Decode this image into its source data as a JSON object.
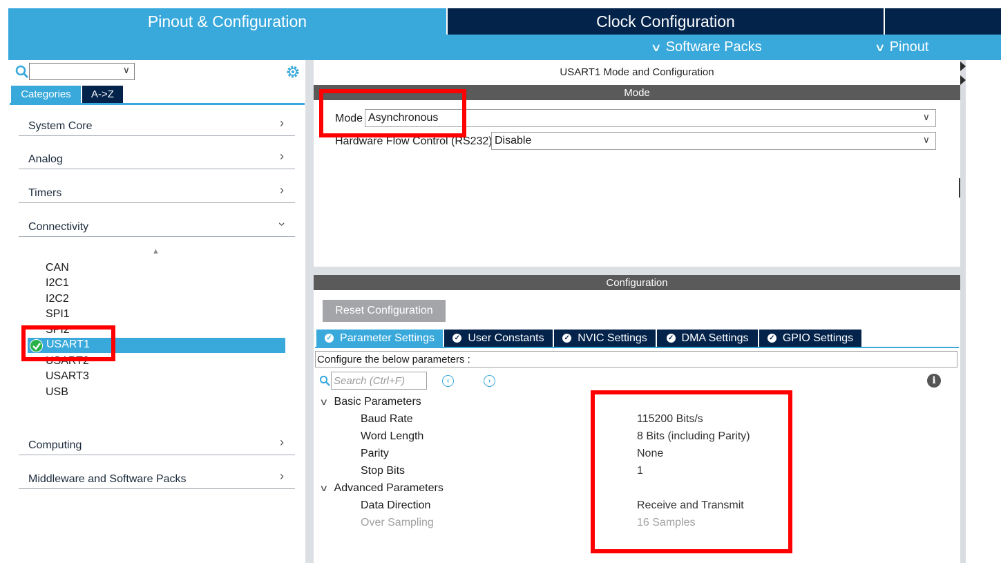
{
  "top_tabs": {
    "pinout": "Pinout & Configuration",
    "clock": "Clock Configuration",
    "extra": ""
  },
  "sub_bar": {
    "software_packs": "Software Packs",
    "pinout": "Pinout"
  },
  "left": {
    "search": {
      "value": ""
    },
    "tabs": {
      "categories": "Categories",
      "az": "A->Z"
    },
    "categories": [
      {
        "label": "System Core",
        "expanded": false
      },
      {
        "label": "Analog",
        "expanded": false
      },
      {
        "label": "Timers",
        "expanded": false
      },
      {
        "label": "Connectivity",
        "expanded": true
      },
      {
        "label": "Computing",
        "expanded": false
      },
      {
        "label": "Middleware and Software Packs",
        "expanded": false
      }
    ],
    "connectivity_items": [
      "CAN",
      "I2C1",
      "I2C2",
      "SPI1",
      "SPI2",
      "USART1",
      "USART2",
      "USART3",
      "USB"
    ],
    "selected_item": "USART1"
  },
  "right": {
    "title": "USART1 Mode and Configuration",
    "mode_section": "Mode",
    "mode_label": "Mode",
    "mode_value": "Asynchronous",
    "hw_flow_label": "Hardware Flow Control (RS232)",
    "hw_flow_value": "Disable",
    "config_section": "Configuration",
    "reset_button": "Reset Configuration",
    "config_tabs": [
      "Parameter Settings",
      "User Constants",
      "NVIC Settings",
      "DMA Settings",
      "GPIO Settings"
    ],
    "active_tab": "Parameter Settings",
    "configure_text": "Configure the below parameters :",
    "search_placeholder": "Search (Ctrl+F)",
    "basic_group": "Basic Parameters",
    "advanced_group": "Advanced Parameters",
    "parameters": {
      "baud_rate": {
        "name": "Baud Rate",
        "value": "115200 Bits/s"
      },
      "word_length": {
        "name": "Word Length",
        "value": "8 Bits (including Parity)"
      },
      "parity": {
        "name": "Parity",
        "value": "None"
      },
      "stop_bits": {
        "name": "Stop Bits",
        "value": "1"
      },
      "data_direction": {
        "name": "Data Direction",
        "value": "Receive and Transmit"
      },
      "over_sampling": {
        "name": "Over Sampling",
        "value": "16 Samples"
      }
    }
  },
  "colors": {
    "accent_blue": "#39a9dc",
    "navy": "#03234b",
    "section_gray": "#5a5a5a",
    "highlight_red": "#ff0000",
    "check_green": "#29b24a"
  }
}
